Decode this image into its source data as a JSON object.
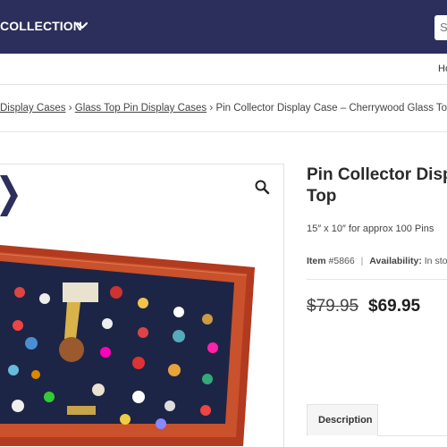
{
  "header": {
    "nav_label": "COLLECTION",
    "search_placeholder": "S",
    "brand_color": "#2c2f5b"
  },
  "subbar": {
    "text": "Ho"
  },
  "breadcrumb": {
    "items": [
      "Display Cases",
      "Glass Top Pin Display Cases"
    ],
    "current": "Pin Collector Display Case – Cherrywood Glass Top",
    "separator": "›"
  },
  "product": {
    "title_line1": "Pin Collector Displ",
    "title_line2": "Top",
    "size_text": "15″ x 10″ for approx 100 Pins",
    "item_label": "Item",
    "item_number": "#5866",
    "availability_label": "Availability:",
    "availability_value": "In stoc",
    "price_old": "$79.95",
    "price_new": "$69.95"
  },
  "tabs": [
    {
      "label": "Description"
    }
  ],
  "icons": {
    "zoom": "magnifier-icon",
    "chevron": "chevron-down-icon"
  }
}
